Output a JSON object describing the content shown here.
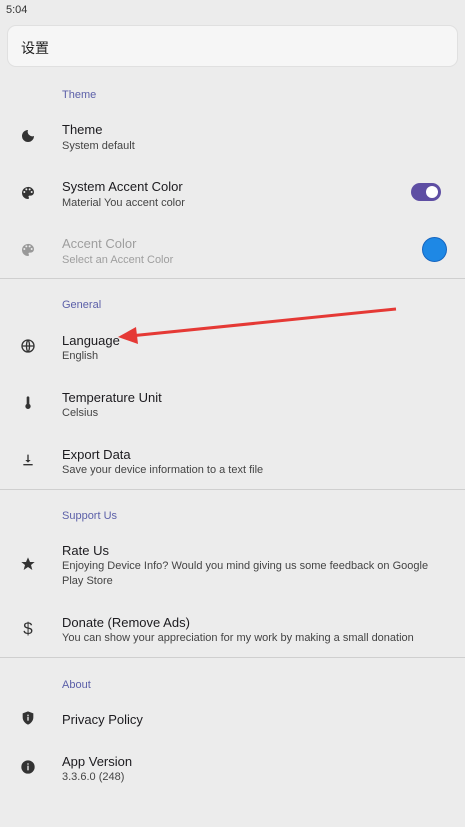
{
  "status_bar": {
    "time": "5:04"
  },
  "header": {
    "title": "设置"
  },
  "sections": {
    "theme": {
      "header": "Theme",
      "items": [
        {
          "title": "Theme",
          "subtitle": "System default",
          "icon": "moon-icon"
        },
        {
          "title": "System Accent Color",
          "subtitle": "Material You accent color",
          "icon": "palette-icon",
          "toggle_on": true
        },
        {
          "title": "Accent Color",
          "subtitle": "Select an Accent Color",
          "icon": "palette-icon",
          "disabled": true,
          "color": "#1e88e5"
        }
      ]
    },
    "general": {
      "header": "General",
      "items": [
        {
          "title": "Language",
          "subtitle": "English",
          "icon": "globe-icon"
        },
        {
          "title": "Temperature Unit",
          "subtitle": "Celsius",
          "icon": "thermometer-icon"
        },
        {
          "title": "Export Data",
          "subtitle": "Save your device information to a text file",
          "icon": "download-icon"
        }
      ]
    },
    "support": {
      "header": "Support Us",
      "items": [
        {
          "title": "Rate Us",
          "subtitle": "Enjoying Device Info? Would you mind giving us some feedback on Google Play Store",
          "icon": "star-icon"
        },
        {
          "title": "Donate (Remove Ads)",
          "subtitle": "You can show your appreciation for my work by making a small donation",
          "icon": "dollar-icon"
        }
      ]
    },
    "about": {
      "header": "About",
      "items": [
        {
          "title": "Privacy Policy",
          "icon": "shield-icon"
        },
        {
          "title": "App Version",
          "subtitle": "3.3.6.0 (248)",
          "icon": "info-icon"
        }
      ]
    }
  },
  "colors": {
    "accent": "#5e4ea3",
    "section_header": "#5b5fa8",
    "annotation_arrow": "#e53935"
  }
}
